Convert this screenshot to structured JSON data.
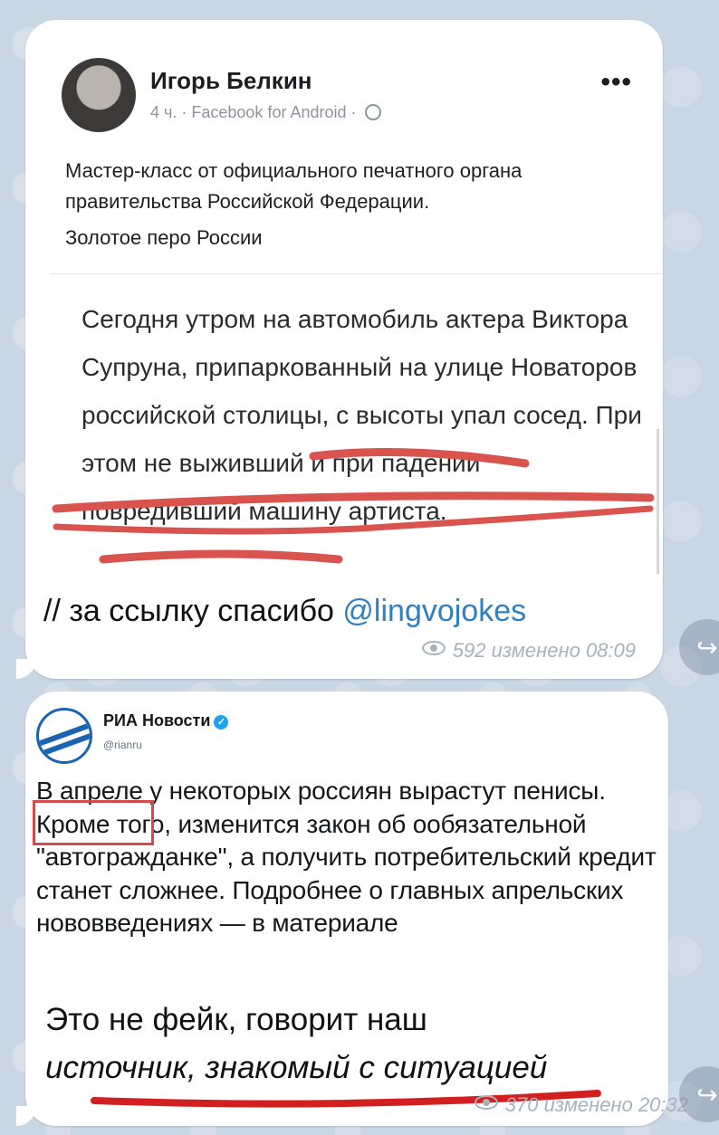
{
  "post1": {
    "author": "Игорь Белкин",
    "meta": "4 ч. · Facebook for Android ·",
    "text": "Мастер-класс от официального печатного органа правительства Российской Федерации.",
    "subtext": "Золотое перо России",
    "quote": "Сегодня утром на автомобиль актера Виктора Супруна, припаркованный на улице Новаторов российской столицы, с высоты упал сосед. При этом не выживший и при падении повредивший машину артиста.",
    "caption_prefix": "// за ссылку спасибо ",
    "caption_link": "@lingvojokes",
    "views": "592",
    "edited_time": "изменено 08:09",
    "underline_color": "#d9534f"
  },
  "post2": {
    "source_name": "РИА Новости",
    "source_handle": "@rianru",
    "tweet": "В апреле у некоторых россиян вырастут пенисы. Кроме того, изменится закон об ообязательной \"автогражданке\", а получить потребительский кредит станет сложнее. Подробнее о главных апрельских нововведениях — в материале",
    "comment_plain": "Это не фейк, говорит наш",
    "comment_italic": "источник, знакомый с ситуацией",
    "views": "370",
    "edited_time": "изменено 20:32",
    "highlight_color": "#d24a4a"
  },
  "icons": {
    "share": "↪",
    "more": "•••",
    "verified": "✓"
  },
  "colors": {
    "background": "#c9d6e4",
    "link": "#2f7fc4",
    "meta": "#a7b2bd"
  }
}
